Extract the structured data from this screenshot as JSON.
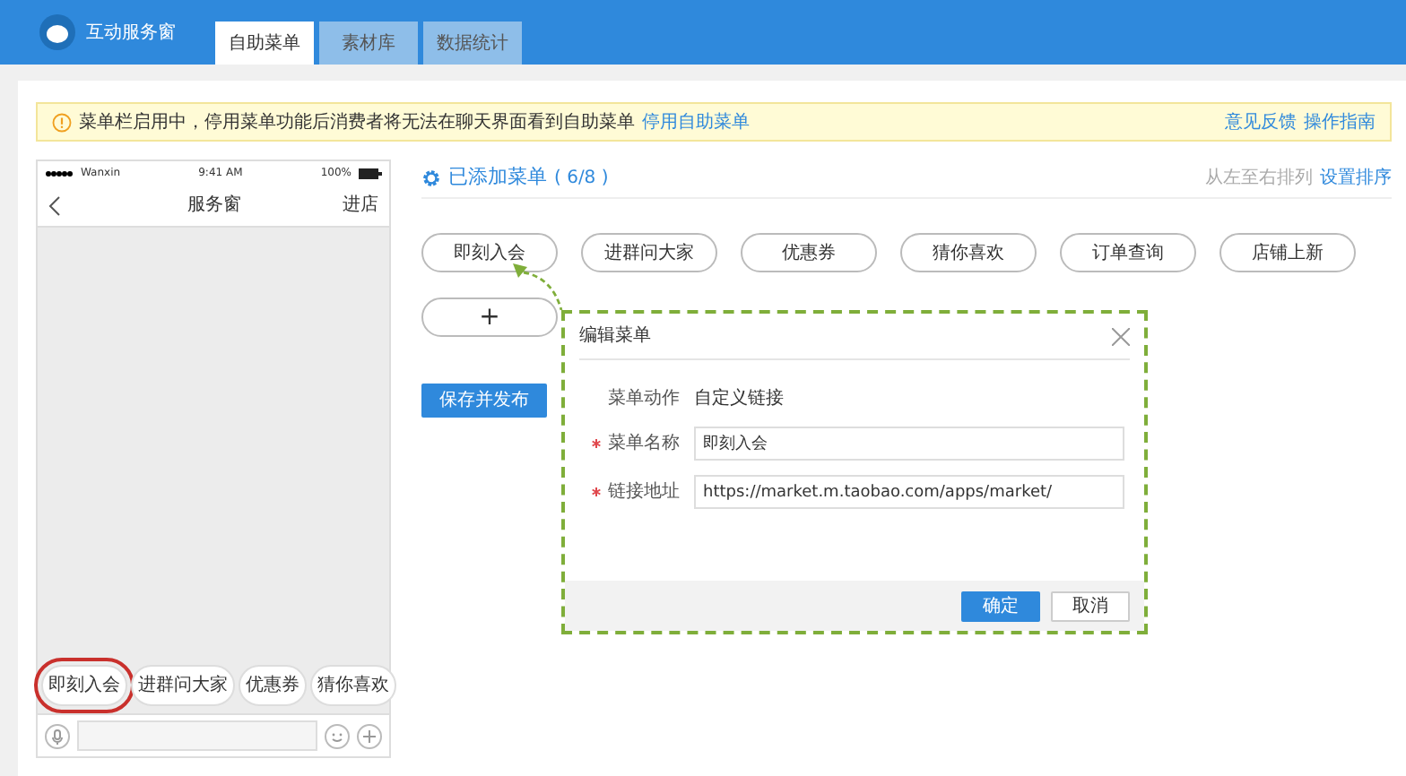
{
  "header": {
    "app_name": "互动服务窗",
    "tabs": [
      {
        "label": "自助菜单",
        "selected": true
      },
      {
        "label": "素材库",
        "selected": false
      },
      {
        "label": "数据统计",
        "selected": false
      }
    ]
  },
  "notice": {
    "text": "菜单栏启用中，停用菜单功能后消费者将无法在聊天界面看到自助菜单",
    "link": "停用自助菜单",
    "actions": [
      "意见反馈",
      "操作指南"
    ]
  },
  "phone": {
    "carrier": "Wanxin",
    "time": "9:41 AM",
    "battery": "100%",
    "title": "服务窗",
    "right_action": "进店",
    "menu_items": [
      {
        "label": "即刻入会",
        "highlighted": true
      },
      {
        "label": "进群问大家",
        "highlighted": false
      },
      {
        "label": "优惠券",
        "highlighted": false
      },
      {
        "label": "猜你喜欢",
        "highlighted": false
      }
    ]
  },
  "menu_panel": {
    "title": "已添加菜单",
    "count": "( 6/8 )",
    "sort_hint": "从左至右排列",
    "sort_link": "设置排序",
    "items": [
      "即刻入会",
      "进群问大家",
      "优惠券",
      "猜你喜欢",
      "订单查询",
      "店铺上新"
    ],
    "add_button": "+",
    "publish_button": "保存并发布"
  },
  "dialog": {
    "title": "编辑菜单",
    "fields": [
      {
        "kind": "text",
        "label": "菜单动作",
        "required": false,
        "value": "自定义链接"
      },
      {
        "kind": "input",
        "label": "菜单名称",
        "required": true,
        "value": "即刻入会"
      },
      {
        "kind": "input",
        "label": "链接地址",
        "required": true,
        "value": "https://market.m.taobao.com/apps/market/"
      }
    ],
    "buttons": [
      {
        "label": "确定",
        "kind": "primary"
      },
      {
        "label": "取消",
        "kind": "secondary"
      }
    ]
  }
}
